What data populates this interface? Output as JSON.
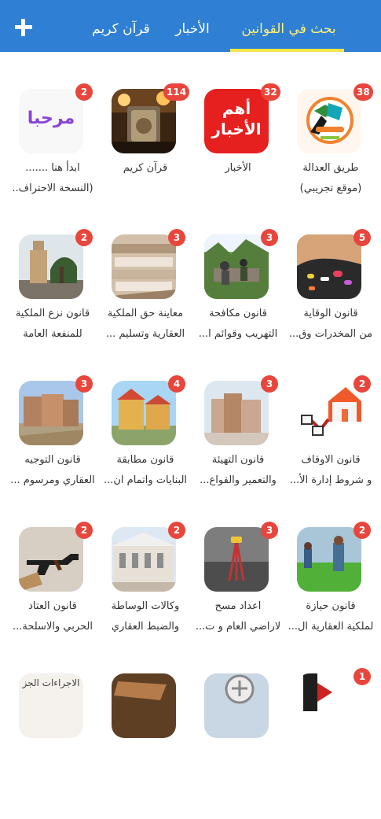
{
  "header": {
    "tabs": [
      "بحث في القوانين",
      "الأخبار",
      "قرآن كريم"
    ]
  },
  "tiles": [
    {
      "badge": "38",
      "lines": [
        "طريق العدالة",
        "(موقع تجريبي)"
      ]
    },
    {
      "badge": "32",
      "lines": [
        "الأخبار",
        ""
      ]
    },
    {
      "badge": "114",
      "lines": [
        "قرآن كريم",
        ""
      ]
    },
    {
      "badge": "2",
      "lines": [
        "ابدأ هنا .......",
        "(النسخة الاحتراف.."
      ]
    },
    {
      "badge": "5",
      "lines": [
        "قانون الوقاية",
        "من المخدرات وق..."
      ]
    },
    {
      "badge": "3",
      "lines": [
        "قانون مكافحة",
        "التهريب وقوائم ا..."
      ]
    },
    {
      "badge": "3",
      "lines": [
        "معاينة حق الملكية",
        "العقارية وتسليم ..."
      ]
    },
    {
      "badge": "2",
      "lines": [
        "قانون نزع الملكية",
        "للمنفعة العامة"
      ]
    },
    {
      "badge": "2",
      "lines": [
        "قانون الاوقاف",
        "و شروط إدارة الأ..."
      ]
    },
    {
      "badge": "3",
      "lines": [
        "قانون التهيئة",
        "والتعمير والقواع..."
      ]
    },
    {
      "badge": "4",
      "lines": [
        "قانون مطابقة",
        "البنايات واتمام ان..."
      ]
    },
    {
      "badge": "3",
      "lines": [
        "قانون التوجيه",
        "العقاري ومرسوم ..."
      ]
    },
    {
      "badge": "2",
      "lines": [
        "قانون حيازة",
        "لملكية العقارية ال..."
      ]
    },
    {
      "badge": "3",
      "lines": [
        "اعداد مسح",
        "لاراضي العام و ت..."
      ]
    },
    {
      "badge": "2",
      "lines": [
        "وكالات الوساطة",
        "والضبط العقاري"
      ]
    },
    {
      "badge": "2",
      "lines": [
        "قانون العتاد",
        "الحربي والاسلحة..."
      ]
    },
    {
      "badge": "1",
      "lines": [
        "",
        ""
      ]
    },
    {
      "badge": "",
      "lines": [
        "",
        ""
      ]
    },
    {
      "badge": "",
      "lines": [
        "",
        ""
      ]
    },
    {
      "badge": "",
      "lines": [
        "الاجراءات الجز",
        ""
      ]
    }
  ],
  "thumbnail_texts": {
    "news": [
      "أهم",
      "الأخبار"
    ],
    "welcome": "مرحبا"
  }
}
